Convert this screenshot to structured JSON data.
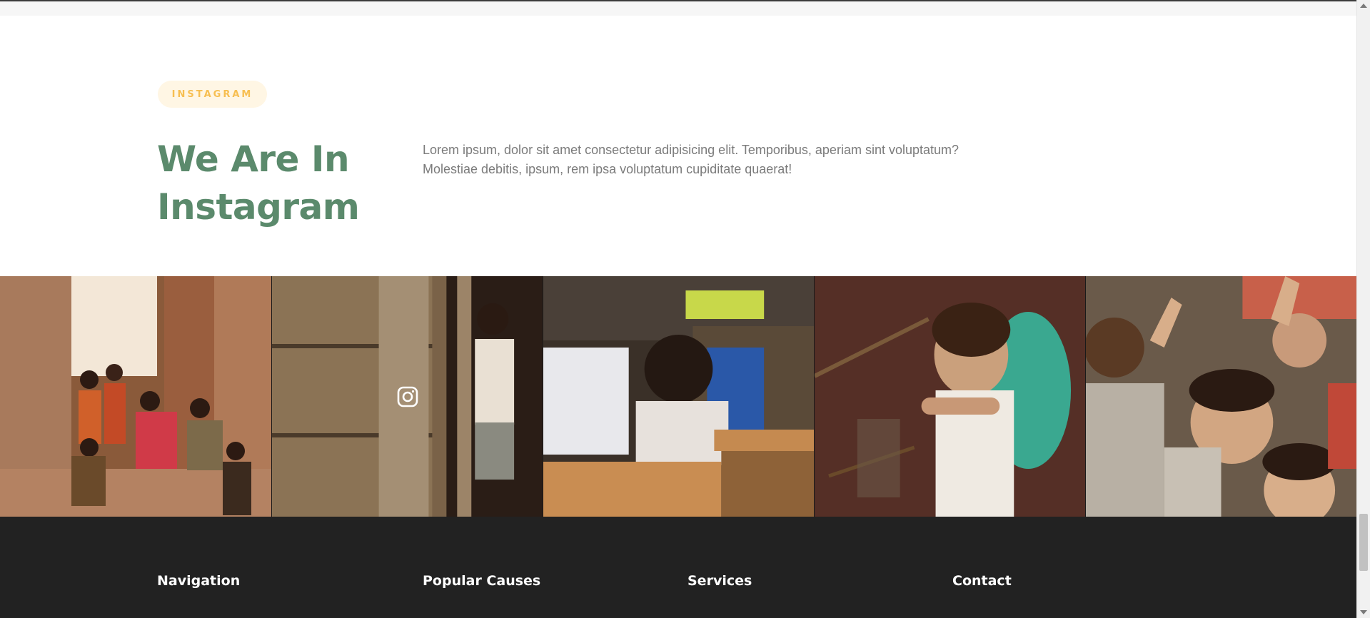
{
  "section": {
    "badge": "INSTAGRAM",
    "heading": "We Are In Instagram",
    "description": "Lorem ipsum, dolor sit amet consectetur adipisicing elit. Temporibus, aperiam sint voluptatum? Molestiae debitis, ipsum, rem ipsa voluptatum cupiditate quaerat!"
  },
  "gallery": {
    "photos": [
      {
        "name": "children-in-doorway"
      },
      {
        "name": "child-by-wooden-wall"
      },
      {
        "name": "children-at-school-desks"
      },
      {
        "name": "smiling-child-in-chair"
      },
      {
        "name": "children-peace-signs"
      }
    ],
    "hover_icon": "instagram-icon"
  },
  "footer": {
    "columns": [
      "Navigation",
      "Popular Causes",
      "Services",
      "Contact"
    ]
  },
  "colors": {
    "accent_green": "#5b8a6c",
    "badge_bg": "#fff6e4",
    "badge_text": "#f7bf52",
    "footer_bg": "#222222"
  }
}
